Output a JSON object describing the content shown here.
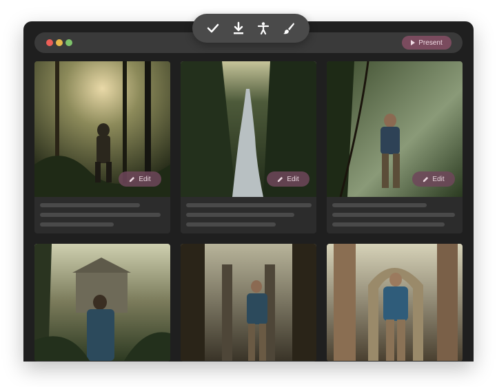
{
  "toolbar": {
    "icons": [
      "checkmark-icon",
      "download-icon",
      "accessibility-icon",
      "brush-icon"
    ]
  },
  "window": {
    "present_label": "Present",
    "traffic_lights": [
      "#ed5f57",
      "#e8b94a",
      "#7ec36b"
    ]
  },
  "cards": [
    {
      "edit_label": "Edit"
    },
    {
      "edit_label": "Edit"
    },
    {
      "edit_label": "Edit"
    }
  ],
  "colors": {
    "window_bg": "#1f1f1f",
    "card_bg": "#2c2c2c",
    "accent": "#7a4b5e"
  }
}
